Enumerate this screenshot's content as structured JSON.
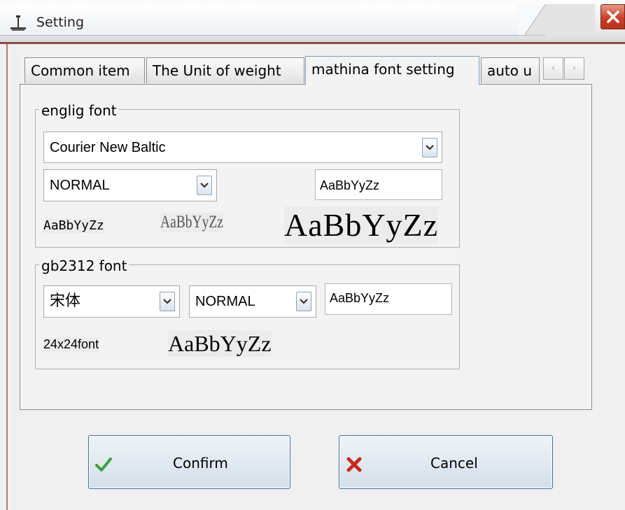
{
  "window": {
    "title": "Setting",
    "close_glyph": "✕"
  },
  "tabs": [
    {
      "label": "Common item",
      "active": false
    },
    {
      "label": "The Unit of weight",
      "active": false
    },
    {
      "label": "mathina font setting",
      "active": true
    },
    {
      "label": "auto u",
      "active": false
    }
  ],
  "tab_scroll": {
    "left_glyph": "‹",
    "right_glyph": "›"
  },
  "english_group": {
    "title": "englig font",
    "font_value": "Courier New Baltic",
    "style_value": "NORMAL",
    "preview_text": "AaBbYyZz",
    "sample_small": "AaBbYyZz",
    "sample_medium": "AaBbYyZz",
    "sample_large": "AaBbYyZz"
  },
  "gb_group": {
    "title": "gb2312 font",
    "font_value": "宋体",
    "style_value": "NORMAL",
    "preview_text": "AaBbYyZz",
    "size_label": "24x24font",
    "sample": "AaBbYyZz"
  },
  "buttons": {
    "confirm_label": "Confirm",
    "cancel_label": "Cancel"
  },
  "colors": {
    "confirm_icon": "#3aa03a",
    "cancel_icon": "#c8281e",
    "close_button": "#c9402a",
    "frame": "#8e4a4a"
  },
  "icons": {
    "app": "scale-icon",
    "close": "close-icon",
    "dropdown": "chevron-down-icon",
    "confirm": "checkmark-icon",
    "cancel": "x-mark-icon"
  }
}
